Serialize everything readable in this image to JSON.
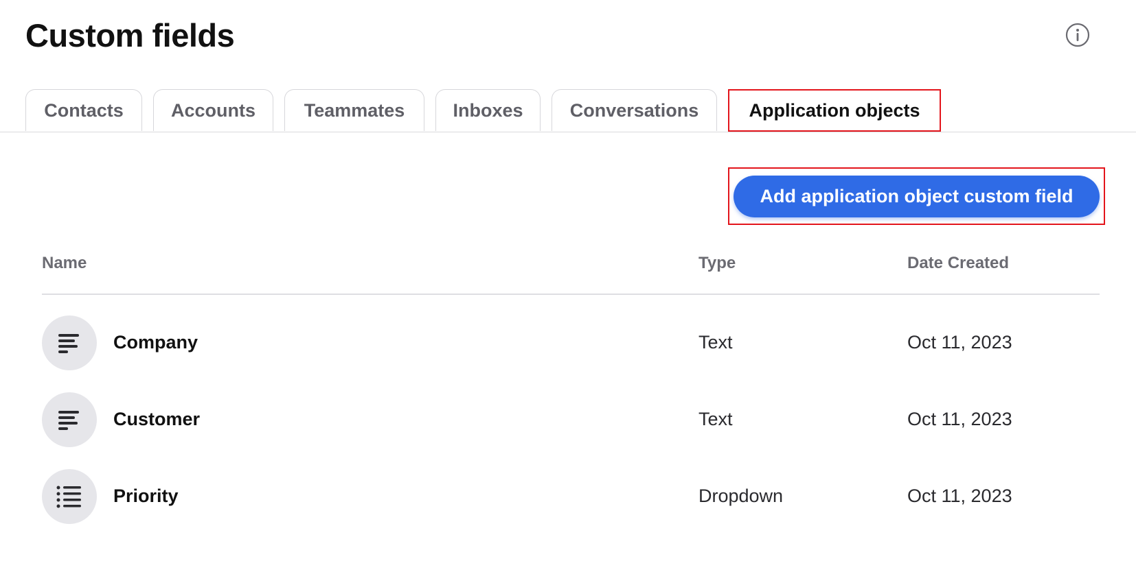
{
  "page": {
    "title": "Custom fields"
  },
  "header": {
    "info_icon": "info-circle-icon"
  },
  "tabs": [
    {
      "label": "Contacts",
      "active": false
    },
    {
      "label": "Accounts",
      "active": false
    },
    {
      "label": "Teammates",
      "active": false
    },
    {
      "label": "Inboxes",
      "active": false
    },
    {
      "label": "Conversations",
      "active": false
    },
    {
      "label": "Application objects",
      "active": true
    }
  ],
  "toolbar": {
    "add_label": "Add application object custom field"
  },
  "table": {
    "columns": [
      "Name",
      "Type",
      "Date Created"
    ],
    "rows": [
      {
        "name": "Company",
        "type": "Text",
        "date_created": "Oct 11, 2023",
        "icon": "text-lines-icon"
      },
      {
        "name": "Customer",
        "type": "Text",
        "date_created": "Oct 11, 2023",
        "icon": "text-lines-icon"
      },
      {
        "name": "Priority",
        "type": "Dropdown",
        "date_created": "Oct 11, 2023",
        "icon": "bullet-list-icon"
      }
    ]
  },
  "colors": {
    "accent": "#2f6be6",
    "highlight": "#e3141b",
    "icon_bg": "#e6e6ea"
  }
}
